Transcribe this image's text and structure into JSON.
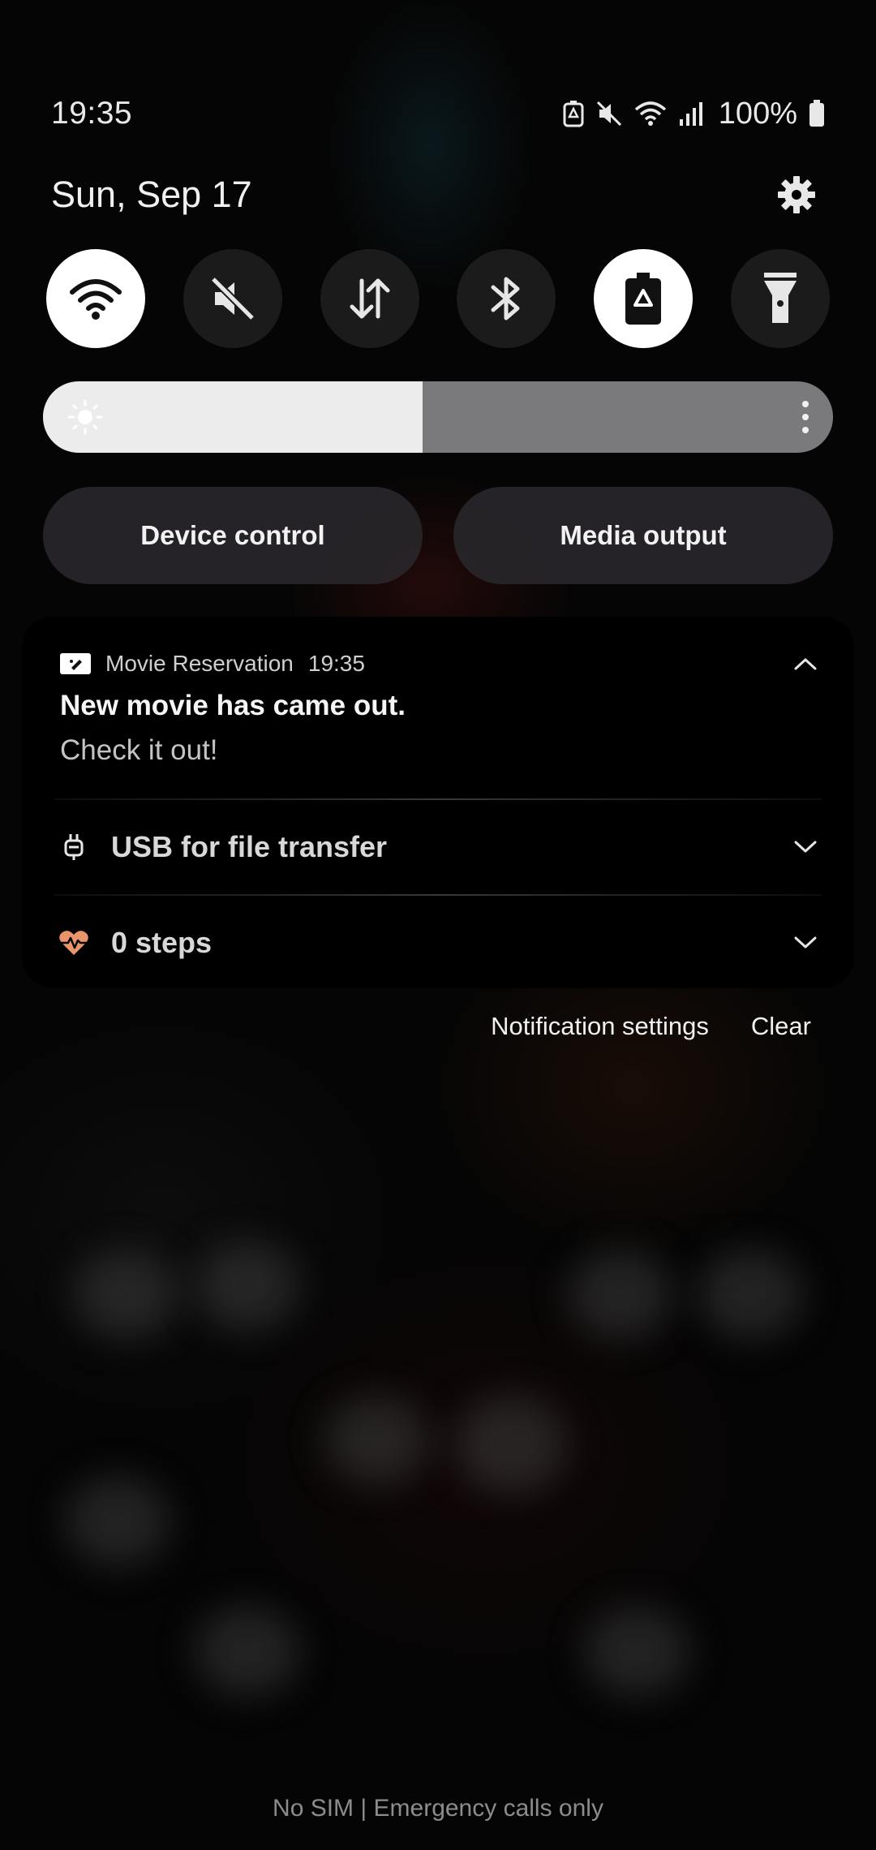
{
  "status_bar": {
    "time": "19:35",
    "battery_percent": "100%",
    "icons": [
      "battery-saver-icon",
      "mute-icon",
      "wifi-icon",
      "signal-icon",
      "battery-icon"
    ]
  },
  "header": {
    "date": "Sun, Sep 17"
  },
  "quick_toggles": [
    {
      "name": "wifi-icon",
      "on": true
    },
    {
      "name": "mute-icon",
      "on": false
    },
    {
      "name": "mobile-data-icon",
      "on": false
    },
    {
      "name": "bluetooth-icon",
      "on": false
    },
    {
      "name": "power-saving-icon",
      "on": true
    },
    {
      "name": "flashlight-icon",
      "on": false
    }
  ],
  "brightness": {
    "level": 0.48
  },
  "buttons": {
    "device_control": "Device control",
    "media_output": "Media output"
  },
  "notifications": {
    "movie": {
      "app_name": "Movie Reservation",
      "time": "19:35",
      "title": "New movie has came out.",
      "body": "Check it out!"
    },
    "usb": {
      "label": "USB for file transfer"
    },
    "steps": {
      "label": "0 steps"
    }
  },
  "actions": {
    "notification_settings": "Notification settings",
    "clear": "Clear"
  },
  "footer": {
    "carrier_text": "No SIM | Emergency calls only"
  },
  "colors": {
    "background": "#000000",
    "toggle_on": "#ffffff",
    "toggle_off": "#1b1b1b",
    "brightness_fill": "#ececec",
    "brightness_track": "#7a7a7c",
    "steps_heart": "#e8956b"
  }
}
